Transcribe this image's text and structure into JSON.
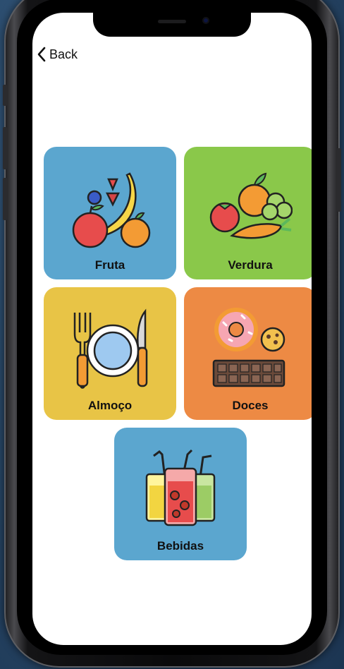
{
  "nav": {
    "back_label": "Back"
  },
  "categories": [
    {
      "label": "Fruta",
      "color": "#5ba6cf",
      "icon": "fruit-icon"
    },
    {
      "label": "Verdura",
      "color": "#8ac84a",
      "icon": "vegetable-icon"
    },
    {
      "label": "Almoço",
      "color": "#e8c446",
      "icon": "lunch-icon"
    },
    {
      "label": "Doces",
      "color": "#ed8a44",
      "icon": "sweets-icon"
    },
    {
      "label": "Bebidas",
      "color": "#5ba6cf",
      "icon": "drinks-icon"
    }
  ]
}
